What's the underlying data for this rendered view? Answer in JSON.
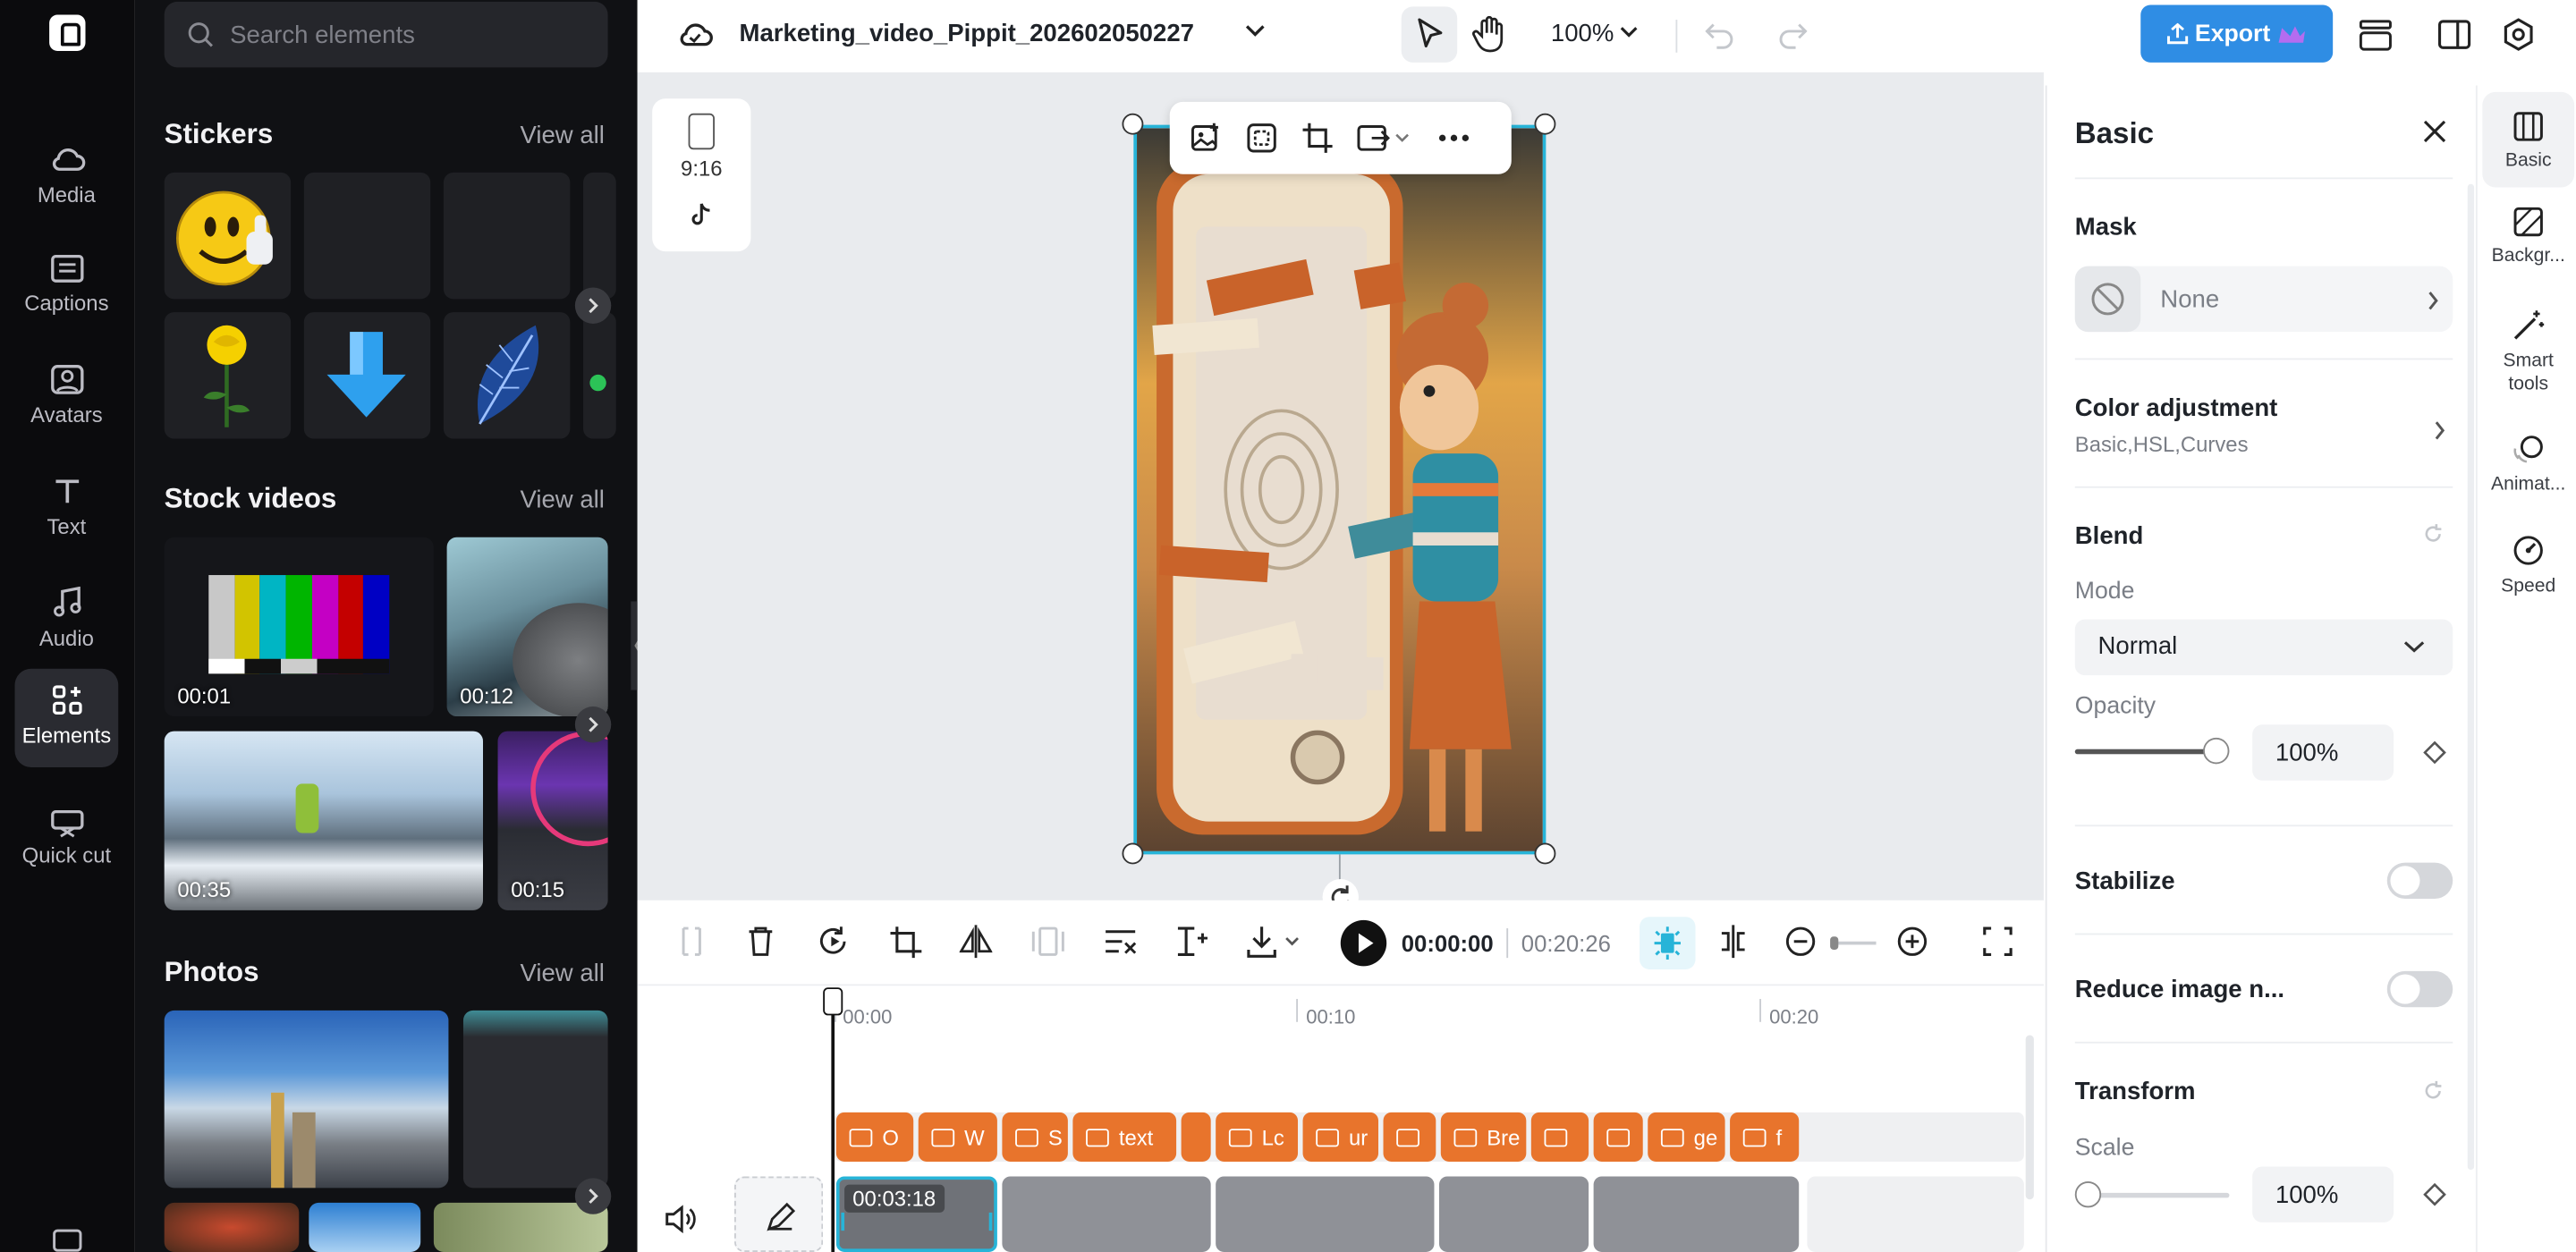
{
  "rail": {
    "items": [
      {
        "label": "Media",
        "icon": "cloud-icon"
      },
      {
        "label": "Captions",
        "icon": "captions-icon"
      },
      {
        "label": "Avatars",
        "icon": "avatar-icon"
      },
      {
        "label": "Text",
        "icon": "text-icon"
      },
      {
        "label": "Audio",
        "icon": "music-note-icon"
      },
      {
        "label": "Elements",
        "icon": "elements-icon",
        "active": true
      },
      {
        "label": "Quick cut",
        "icon": "quick-cut-icon"
      }
    ]
  },
  "panel": {
    "search_placeholder": "Search elements",
    "stickers": {
      "title": "Stickers",
      "view_all": "View all"
    },
    "stock_videos": {
      "title": "Stock videos",
      "view_all": "View all",
      "items": [
        {
          "duration": "00:01"
        },
        {
          "duration": "00:12"
        },
        {
          "duration": "00:35"
        },
        {
          "duration": "00:15"
        }
      ]
    },
    "photos": {
      "title": "Photos",
      "view_all": "View all"
    }
  },
  "topbar": {
    "project_name": "Marketing_video_Pippit_202602050227",
    "zoom": "100%",
    "export_label": "Export",
    "accent": "#2f8de4"
  },
  "canvas": {
    "ratio_label": "9:16"
  },
  "playback": {
    "current_time": "00:00:00",
    "total_time": "00:20:26"
  },
  "timeline": {
    "ticks": [
      "00:00",
      "00:10",
      "00:20"
    ],
    "captions": [
      {
        "text": "O"
      },
      {
        "text": "W"
      },
      {
        "text": "S"
      },
      {
        "text": "text"
      },
      {
        "text": ""
      },
      {
        "text": "Lc"
      },
      {
        "text": "ur"
      },
      {
        "text": ""
      },
      {
        "text": "Bre"
      },
      {
        "text": ""
      },
      {
        "text": ""
      },
      {
        "text": "ge"
      },
      {
        "text": "f"
      }
    ],
    "first_clip_duration": "00:03:18",
    "caption_color": "#e8742c"
  },
  "props": {
    "title": "Basic",
    "mask": {
      "title": "Mask",
      "value": "None"
    },
    "color_adjustment": {
      "title": "Color adjustment",
      "subtitle": "Basic,HSL,Curves"
    },
    "blend": {
      "title": "Blend",
      "mode_label": "Mode",
      "mode_value": "Normal",
      "opacity_label": "Opacity",
      "opacity_value": "100%",
      "opacity_level": 1.0
    },
    "stabilize": {
      "title": "Stabilize",
      "on": false
    },
    "reduce_noise": {
      "title": "Reduce image n...",
      "on": false
    },
    "transform": {
      "title": "Transform",
      "scale_label": "Scale",
      "scale_value": "100%",
      "scale_level": 0.0
    }
  },
  "right_tabs": [
    {
      "label": "Basic",
      "icon": "basic-icon",
      "active": true
    },
    {
      "label": "Backgr...",
      "icon": "background-icon"
    },
    {
      "label": "Smart tools",
      "icon": "magic-wand-icon"
    },
    {
      "label": "Animat...",
      "icon": "animation-icon"
    },
    {
      "label": "Speed",
      "icon": "speed-icon"
    }
  ]
}
